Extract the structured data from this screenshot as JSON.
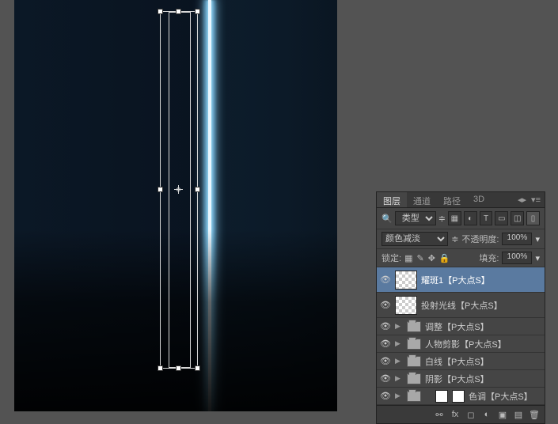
{
  "panel": {
    "tabs": {
      "layers": "图层",
      "channels": "通道",
      "paths": "路径",
      "threeD": "3D"
    },
    "filter": {
      "kind_label": "类型"
    },
    "blend": {
      "mode": "颜色减淡",
      "opacity_label": "不透明度:",
      "opacity_value": "100%"
    },
    "lock": {
      "label": "锁定:",
      "fill_label": "填充:",
      "fill_value": "100%"
    },
    "layers": [
      {
        "name": "耀斑1【P大点S】"
      },
      {
        "name": "投射光线【P大点S】"
      },
      {
        "name": "调整【P大点S】"
      },
      {
        "name": "人物剪影【P大点S】"
      },
      {
        "name": "白线【P大点S】"
      },
      {
        "name": "阴影【P大点S】"
      },
      {
        "name": "色调【P大点S】"
      }
    ]
  }
}
